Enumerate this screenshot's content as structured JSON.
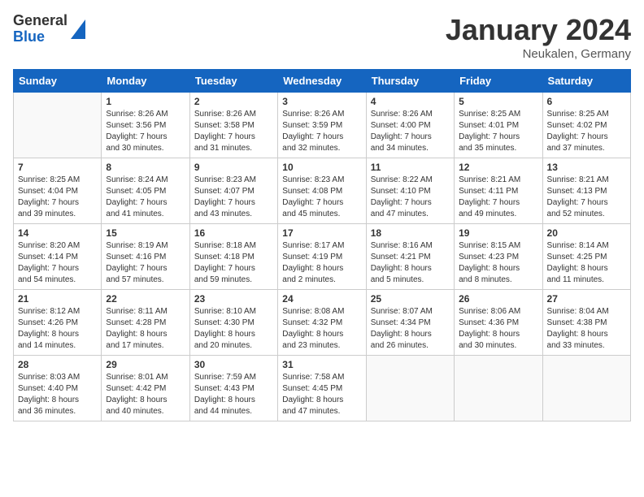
{
  "header": {
    "logo": {
      "general": "General",
      "blue": "Blue"
    },
    "title": "January 2024",
    "location": "Neukalen, Germany"
  },
  "calendar": {
    "days_of_week": [
      "Sunday",
      "Monday",
      "Tuesday",
      "Wednesday",
      "Thursday",
      "Friday",
      "Saturday"
    ],
    "weeks": [
      [
        {
          "day": "",
          "info": ""
        },
        {
          "day": "1",
          "info": "Sunrise: 8:26 AM\nSunset: 3:56 PM\nDaylight: 7 hours\nand 30 minutes."
        },
        {
          "day": "2",
          "info": "Sunrise: 8:26 AM\nSunset: 3:58 PM\nDaylight: 7 hours\nand 31 minutes."
        },
        {
          "day": "3",
          "info": "Sunrise: 8:26 AM\nSunset: 3:59 PM\nDaylight: 7 hours\nand 32 minutes."
        },
        {
          "day": "4",
          "info": "Sunrise: 8:26 AM\nSunset: 4:00 PM\nDaylight: 7 hours\nand 34 minutes."
        },
        {
          "day": "5",
          "info": "Sunrise: 8:25 AM\nSunset: 4:01 PM\nDaylight: 7 hours\nand 35 minutes."
        },
        {
          "day": "6",
          "info": "Sunrise: 8:25 AM\nSunset: 4:02 PM\nDaylight: 7 hours\nand 37 minutes."
        }
      ],
      [
        {
          "day": "7",
          "info": "Sunrise: 8:25 AM\nSunset: 4:04 PM\nDaylight: 7 hours\nand 39 minutes."
        },
        {
          "day": "8",
          "info": "Sunrise: 8:24 AM\nSunset: 4:05 PM\nDaylight: 7 hours\nand 41 minutes."
        },
        {
          "day": "9",
          "info": "Sunrise: 8:23 AM\nSunset: 4:07 PM\nDaylight: 7 hours\nand 43 minutes."
        },
        {
          "day": "10",
          "info": "Sunrise: 8:23 AM\nSunset: 4:08 PM\nDaylight: 7 hours\nand 45 minutes."
        },
        {
          "day": "11",
          "info": "Sunrise: 8:22 AM\nSunset: 4:10 PM\nDaylight: 7 hours\nand 47 minutes."
        },
        {
          "day": "12",
          "info": "Sunrise: 8:21 AM\nSunset: 4:11 PM\nDaylight: 7 hours\nand 49 minutes."
        },
        {
          "day": "13",
          "info": "Sunrise: 8:21 AM\nSunset: 4:13 PM\nDaylight: 7 hours\nand 52 minutes."
        }
      ],
      [
        {
          "day": "14",
          "info": "Sunrise: 8:20 AM\nSunset: 4:14 PM\nDaylight: 7 hours\nand 54 minutes."
        },
        {
          "day": "15",
          "info": "Sunrise: 8:19 AM\nSunset: 4:16 PM\nDaylight: 7 hours\nand 57 minutes."
        },
        {
          "day": "16",
          "info": "Sunrise: 8:18 AM\nSunset: 4:18 PM\nDaylight: 7 hours\nand 59 minutes."
        },
        {
          "day": "17",
          "info": "Sunrise: 8:17 AM\nSunset: 4:19 PM\nDaylight: 8 hours\nand 2 minutes."
        },
        {
          "day": "18",
          "info": "Sunrise: 8:16 AM\nSunset: 4:21 PM\nDaylight: 8 hours\nand 5 minutes."
        },
        {
          "day": "19",
          "info": "Sunrise: 8:15 AM\nSunset: 4:23 PM\nDaylight: 8 hours\nand 8 minutes."
        },
        {
          "day": "20",
          "info": "Sunrise: 8:14 AM\nSunset: 4:25 PM\nDaylight: 8 hours\nand 11 minutes."
        }
      ],
      [
        {
          "day": "21",
          "info": "Sunrise: 8:12 AM\nSunset: 4:26 PM\nDaylight: 8 hours\nand 14 minutes."
        },
        {
          "day": "22",
          "info": "Sunrise: 8:11 AM\nSunset: 4:28 PM\nDaylight: 8 hours\nand 17 minutes."
        },
        {
          "day": "23",
          "info": "Sunrise: 8:10 AM\nSunset: 4:30 PM\nDaylight: 8 hours\nand 20 minutes."
        },
        {
          "day": "24",
          "info": "Sunrise: 8:08 AM\nSunset: 4:32 PM\nDaylight: 8 hours\nand 23 minutes."
        },
        {
          "day": "25",
          "info": "Sunrise: 8:07 AM\nSunset: 4:34 PM\nDaylight: 8 hours\nand 26 minutes."
        },
        {
          "day": "26",
          "info": "Sunrise: 8:06 AM\nSunset: 4:36 PM\nDaylight: 8 hours\nand 30 minutes."
        },
        {
          "day": "27",
          "info": "Sunrise: 8:04 AM\nSunset: 4:38 PM\nDaylight: 8 hours\nand 33 minutes."
        }
      ],
      [
        {
          "day": "28",
          "info": "Sunrise: 8:03 AM\nSunset: 4:40 PM\nDaylight: 8 hours\nand 36 minutes."
        },
        {
          "day": "29",
          "info": "Sunrise: 8:01 AM\nSunset: 4:42 PM\nDaylight: 8 hours\nand 40 minutes."
        },
        {
          "day": "30",
          "info": "Sunrise: 7:59 AM\nSunset: 4:43 PM\nDaylight: 8 hours\nand 44 minutes."
        },
        {
          "day": "31",
          "info": "Sunrise: 7:58 AM\nSunset: 4:45 PM\nDaylight: 8 hours\nand 47 minutes."
        },
        {
          "day": "",
          "info": ""
        },
        {
          "day": "",
          "info": ""
        },
        {
          "day": "",
          "info": ""
        }
      ]
    ]
  }
}
